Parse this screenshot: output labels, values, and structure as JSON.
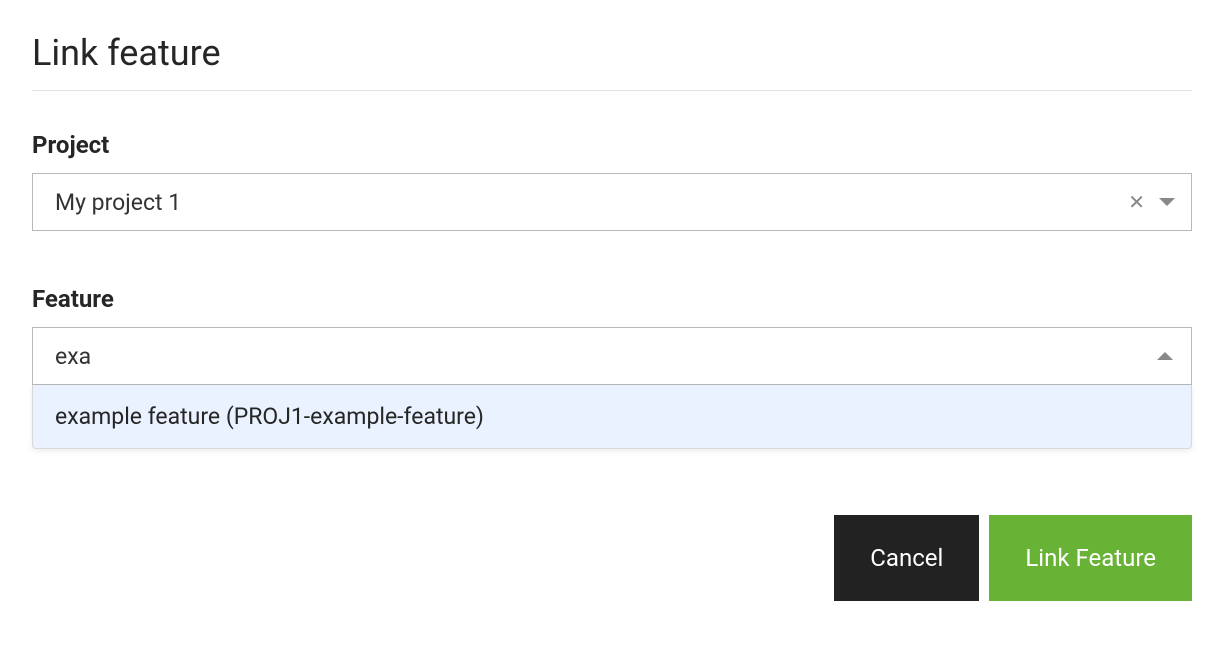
{
  "dialog": {
    "title": "Link feature"
  },
  "project": {
    "label": "Project",
    "selected": "My project 1"
  },
  "feature": {
    "label": "Feature",
    "input_value": "exa",
    "options": [
      {
        "label": "example feature (PROJ1-example-feature)"
      }
    ]
  },
  "buttons": {
    "cancel": "Cancel",
    "submit": "Link Feature"
  }
}
